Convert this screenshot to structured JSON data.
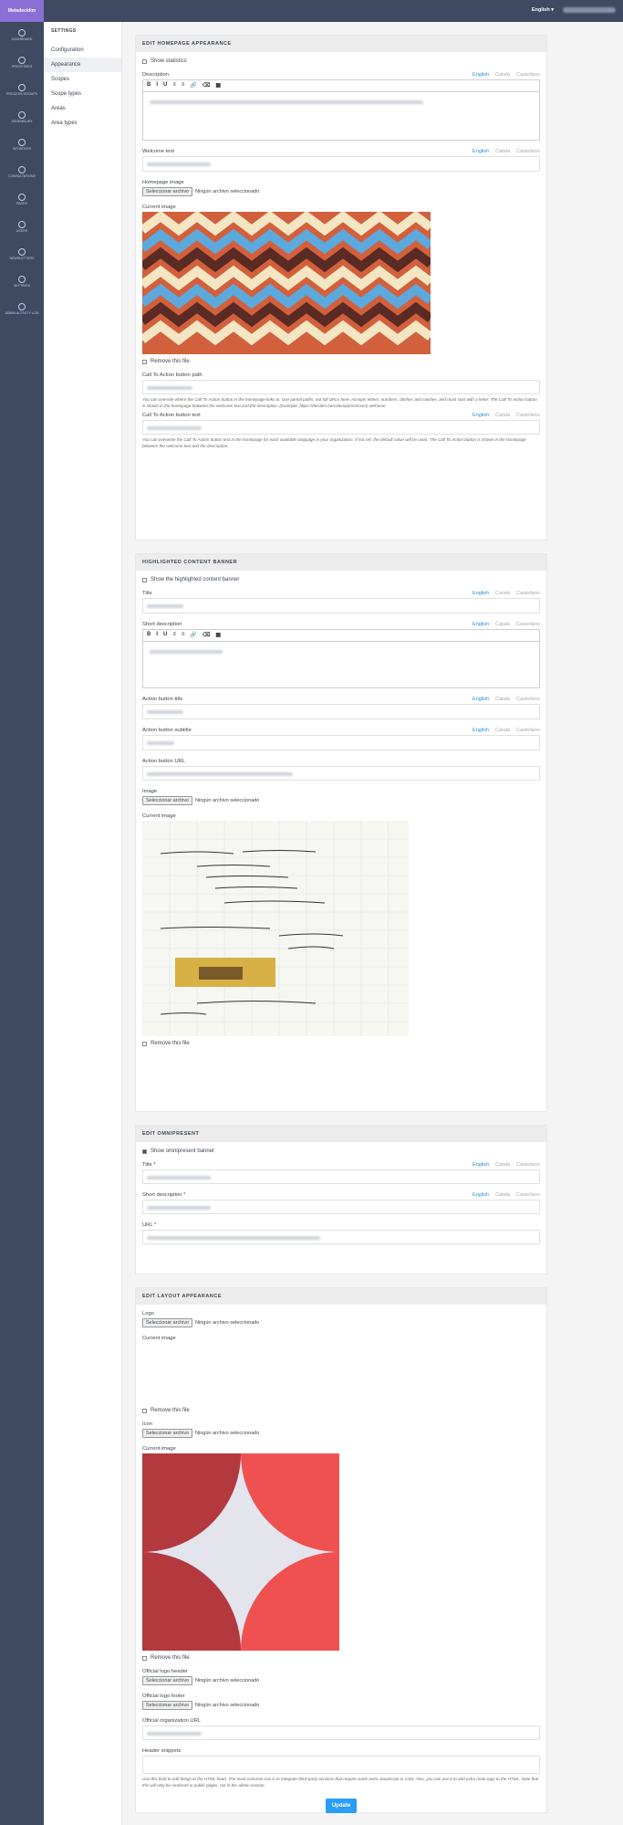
{
  "topbar": {
    "brand": "Metadecidim",
    "language": "English ▾"
  },
  "sidebar": {
    "items": [
      "Dashboard",
      "Processes",
      "Process groups",
      "Assemblies",
      "Initiatives",
      "Consultations",
      "Pages",
      "Users",
      "Newsletters",
      "Settings",
      "Admin activity log"
    ]
  },
  "settings": {
    "title": "Settings",
    "items": [
      "Configuration",
      "Appearance",
      "Scopes",
      "Scope types",
      "Areas",
      "Area types"
    ],
    "active": 1
  },
  "langs": [
    "English",
    "Català",
    "Castellano"
  ],
  "homepage": {
    "title": "Edit homepage appearance",
    "show_statistics": "Show statistics",
    "description": "Description",
    "welcome": "Welcome text",
    "homepage_image": "Homepage image",
    "file_button": "Seleccionar archivo",
    "no_file": "Ningún archivo seleccionado",
    "current_image": "Current image",
    "remove": "Remove this file",
    "cta_path": "Call To Action button path",
    "cta_path_help": "You can override where the Call To Action button in the homepage links to. Use partial paths, not full URLs here. Accepts letters, numbers, dashes and slashes, and must start with a letter. The Call To Action button is shown in the homepage between the welcome text and the description. (Example: https://decidim.barcelona/processes) welcome",
    "cta_text": "Call To Action button text",
    "cta_text_help": "You can overwrite the Call To Action button text in the homepage for each available language in your organization. If not set, the default value will be used. The Call To Action button is shown in the homepage between the welcome text and the description."
  },
  "highlighted": {
    "title": "Highlighted content banner",
    "show": "Show the highlighted content banner",
    "title_label": "Title",
    "short_description": "Short description",
    "action_title": "Action button title",
    "action_subtitle": "Action button subtitle",
    "action_url": "Action button URL",
    "image": "Image",
    "current_image": "Current image",
    "remove": "Remove this file"
  },
  "omnipresent": {
    "title": "Edit omnipresent",
    "show": "Show omnipresent banner",
    "title_label": "Title *",
    "short_description": "Short description *",
    "url": "URL *"
  },
  "layout": {
    "title": "Edit layout appearance",
    "logo": "Logo",
    "current_image": "Current image",
    "remove": "Remove this file",
    "icon": "Icon",
    "official_logo_header": "Official logo header",
    "official_logo_footer": "Official logo footer",
    "official_url": "Official organization URL",
    "header_snippets": "Header snippets",
    "help": "Use this field to add things to the HTML head. The most common use is to integrate third-party services that require some extra JavaScript or CSS. Also, you can use it to add extra meta tags to the HTML. Note that this will only be rendered in public pages, not in the admin section."
  },
  "update": "Update"
}
